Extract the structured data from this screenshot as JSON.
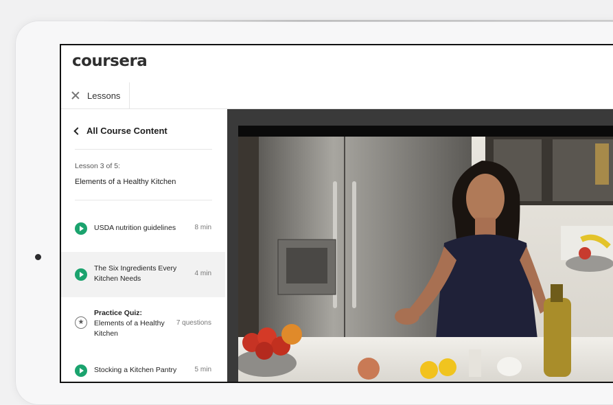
{
  "app": {
    "logo": "coursera"
  },
  "tab": {
    "label": "Lessons"
  },
  "nav": {
    "back_label": "All Course Content"
  },
  "lesson": {
    "count": "Lesson 3 of 5:",
    "title": "Elements of a Healthy Kitchen"
  },
  "items": [
    {
      "title": "USDA nutrition guidelines",
      "meta": "8 min",
      "type": "video"
    },
    {
      "title_line1": "The Six Ingredients Every",
      "title_line2": "Kitchen Needs",
      "meta": "4 min",
      "type": "video",
      "active": true
    },
    {
      "kind": "Practice Quiz:",
      "title_line1": "Elements of a Healthy",
      "title_line2": "Kitchen",
      "meta": "7 questions",
      "type": "quiz"
    },
    {
      "title": "Stocking a Kitchen Pantry",
      "meta": "5 min",
      "type": "video"
    }
  ],
  "colors": {
    "accent_green": "#1ba36e"
  }
}
